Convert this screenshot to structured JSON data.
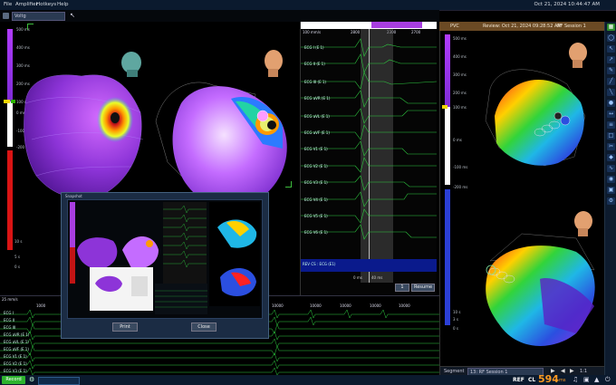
{
  "menu": {
    "items": [
      "File",
      "Amplifier",
      "Hotkeys",
      "Help"
    ],
    "datetime": "Oct 21, 2024 10:44:47 AM"
  },
  "toolbar": {
    "map_combo": "Voltg",
    "close_x": "✕"
  },
  "left_scale": {
    "top_labels": [
      "500 ms",
      "400 ms",
      "300 ms",
      "200 ms",
      "100 ms",
      "0 ms",
      "-100 ms",
      "-200 ms"
    ],
    "bottom_labels": [
      "10 s",
      "10 s",
      "5 s",
      "0 s"
    ]
  },
  "ecg": {
    "speed": "100 mm/s",
    "time_marks": [
      "2800",
      "2300",
      "2700"
    ],
    "leads": [
      "ECG I (E 1)",
      "ECG II (E 1)",
      "ECG III (E 1)",
      "ECG aVR (E 1)",
      "ECG aVL (E 1)",
      "ECG aVF (E 1)",
      "ECG V1 (E 1)",
      "ECG V2 (E 1)",
      "ECG V3 (E 1)",
      "ECG V4 (E 1)",
      "ECG V5 (E 1)",
      "ECG V6 (E 1)"
    ],
    "lead_scale": "100",
    "bottom_lead": "REV CS : ECG (E1)",
    "footer_left": "0 ms",
    "footer_mid": "40 ms",
    "page": "1",
    "resume_label": "Resume"
  },
  "right": {
    "tab": "PVC",
    "review": "Review: Oct 21, 2024 09:28:52 AM",
    "session": "RF Session 1",
    "scale_labels": [
      "500 ms",
      "400 ms",
      "300 ms",
      "200 ms",
      "100 ms",
      "0 ms",
      "-100 ms",
      "-200 ms"
    ],
    "bottom_labels": [
      "10 s",
      "5 s",
      "3 s",
      "0 s"
    ],
    "segment_label": "Segment",
    "segment_value": "13: RF Session 1",
    "zoom": "1:1"
  },
  "bottom": {
    "speed": "25 mm/s",
    "time_marks": [
      "1000",
      "10000",
      "10000",
      "10000",
      "10000",
      "10000"
    ],
    "leads": [
      "ECG I",
      "ECG II",
      "ECG III",
      "ECG aVR (E 1)",
      "ECG aVL (E 1)",
      "ECG aVF (E 1)",
      "ECG V1 (E 1)",
      "ECG V2 (E 1)",
      "ECG V3 (E 1)",
      "ECG V4 (E 1)",
      "ECG V5 (E 1)"
    ]
  },
  "popup": {
    "title": "Snapshot",
    "print_label": "Print",
    "close_label": "Close"
  },
  "status": {
    "record_label": "Record",
    "ref_label": "REF",
    "cl_label": "CL",
    "cl_value": "594",
    "cl_unit": "ms"
  },
  "colors": {
    "accent_green": "#3dbb3d",
    "header_brown": "#6b4a24",
    "cl_orange": "#ff9a1f"
  }
}
